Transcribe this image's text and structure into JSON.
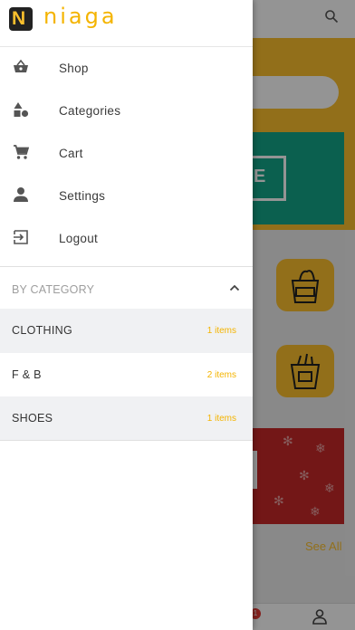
{
  "app": {
    "brand_letter": "N",
    "brand_name": "niaga",
    "brand_color": "#f4b400"
  },
  "menu": [
    {
      "label": "Shop",
      "icon": "basket-icon"
    },
    {
      "label": "Categories",
      "icon": "shapes-icon"
    },
    {
      "label": "Cart",
      "icon": "cart-icon"
    },
    {
      "label": "Settings",
      "icon": "person-icon"
    },
    {
      "label": "Logout",
      "icon": "logout-icon"
    }
  ],
  "category_section": {
    "title": "BY CATEGORY",
    "expanded": true,
    "items": [
      {
        "name": "CLOTHING",
        "count": "1 items"
      },
      {
        "name": "F & B",
        "count": "2 items"
      },
      {
        "name": "SHOES",
        "count": "1 items"
      }
    ]
  },
  "background": {
    "see_all": "See All",
    "banner_letter": "E",
    "cart_badge": "1"
  }
}
